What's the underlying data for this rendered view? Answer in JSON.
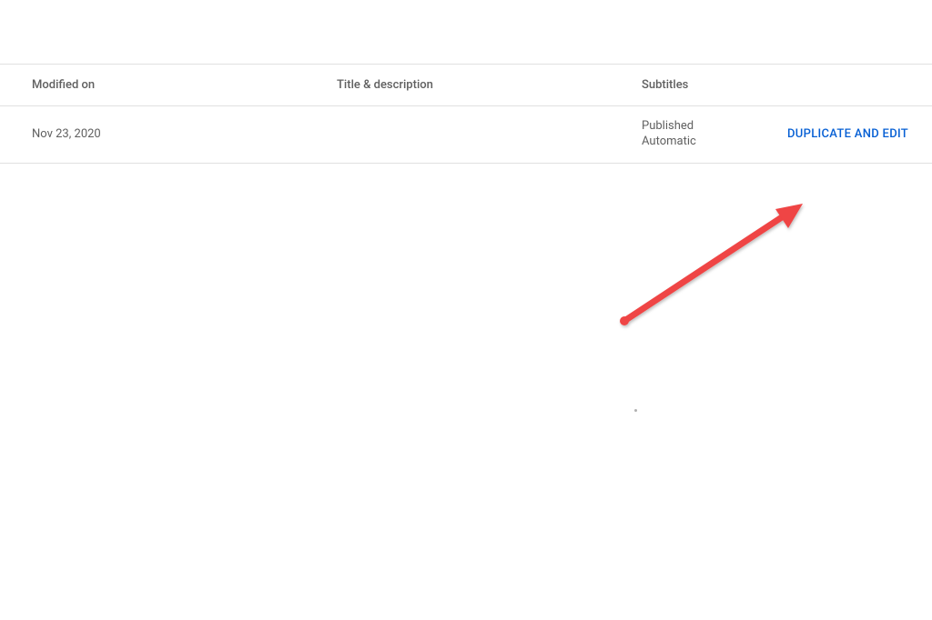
{
  "table": {
    "headers": {
      "modified": "Modified on",
      "title": "Title & description",
      "subtitles": "Subtitles"
    },
    "row": {
      "modified_date": "Nov 23, 2020",
      "subtitle_status_line1": "Published",
      "subtitle_status_line2": "Automatic",
      "action_label": "DUPLICATE AND EDIT"
    }
  },
  "annotation": {
    "arrow_color": "#ef4444"
  }
}
